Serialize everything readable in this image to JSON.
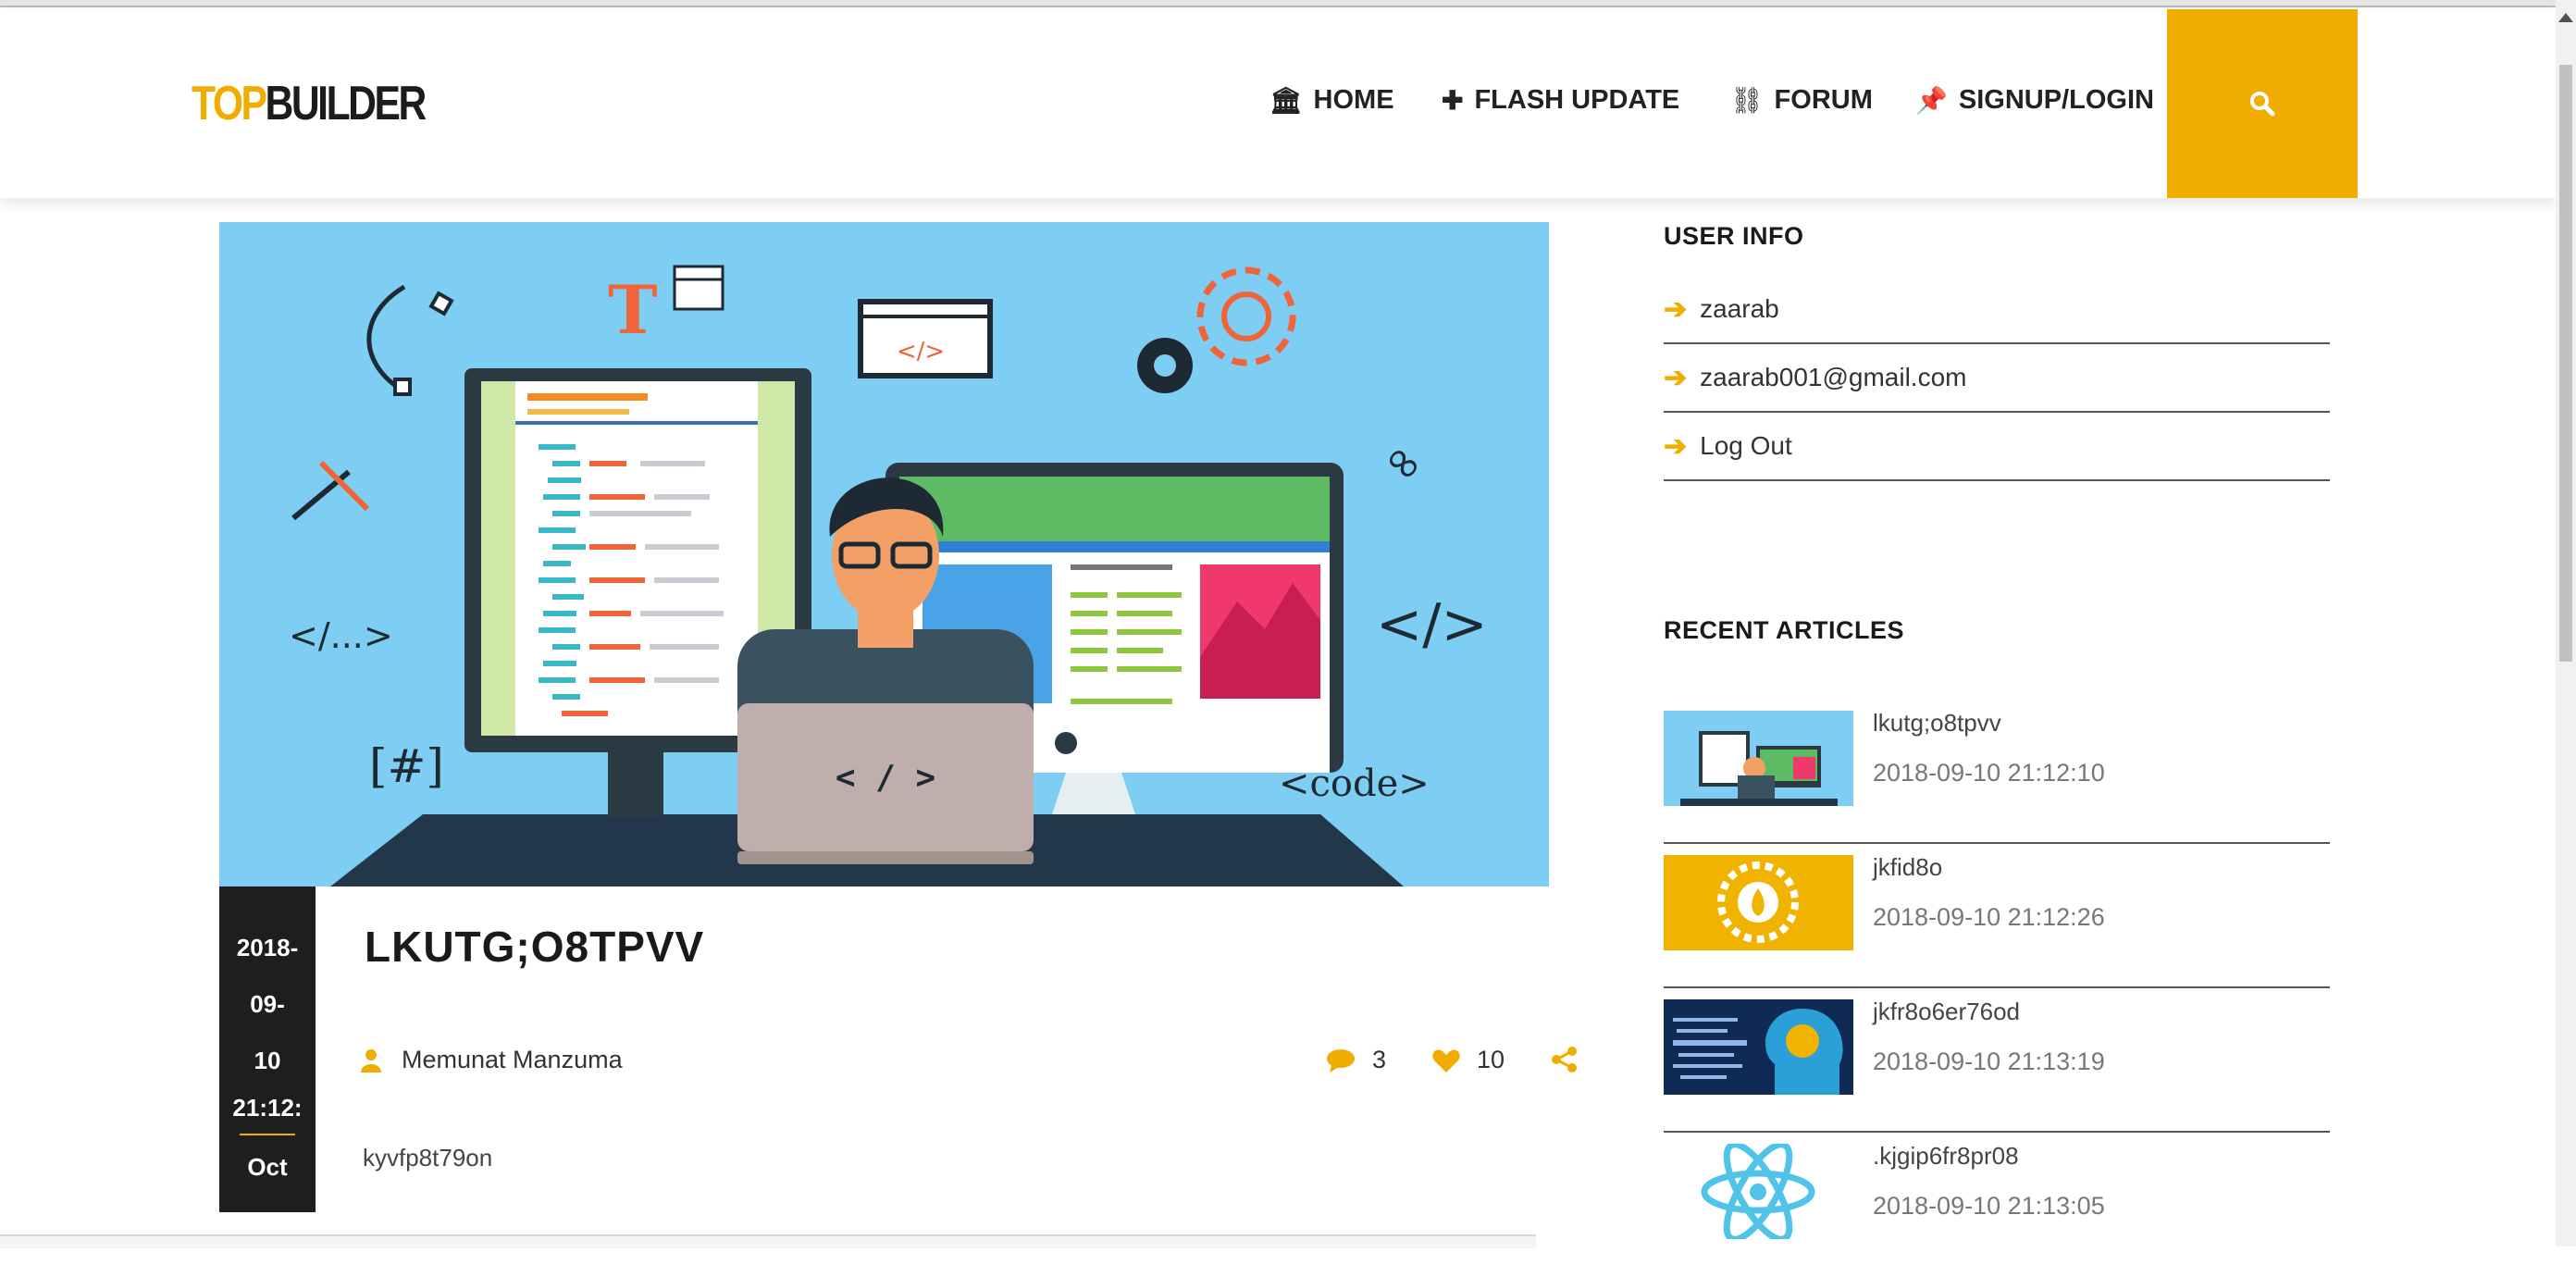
{
  "brand": {
    "logo_a": "TOP",
    "logo_b": "BUILDER"
  },
  "nav": {
    "items": [
      {
        "icon": "bank-icon",
        "label": "HOME"
      },
      {
        "icon": "plus-icon",
        "label": "FLASH UPDATE"
      },
      {
        "icon": "link-icon",
        "label": "FORUM"
      },
      {
        "icon": "pin-icon",
        "label": "SIGNUP/LOGIN"
      }
    ],
    "search_icon": "search-icon"
  },
  "post": {
    "date_lines": [
      "2018-",
      "09-",
      "10",
      "21:12:"
    ],
    "month": "Oct",
    "title": "LKUTG;O8TPVV",
    "author": "Memunat Manzuma",
    "comments": "3",
    "likes": "10",
    "excerpt": "kyvfp8t79on",
    "hero_text": {
      "t_letter": "T",
      "code1": "</...>",
      "code2": "</>",
      "hash": "[#]",
      "code3": "<code>",
      "laptop": "< / >",
      "window": "</>"
    }
  },
  "sidebar": {
    "user_info_title": "USER INFO",
    "user_items": [
      "zaarab",
      "zaarab001@gmail.com",
      "Log Out"
    ],
    "recent_title": "RECENT ARTICLES",
    "articles": [
      {
        "title": "lkutg;o8tpvv",
        "date": "2018-09-10 21:12:10"
      },
      {
        "title": "jkfid8o",
        "date": "2018-09-10 21:12:26"
      },
      {
        "title": "jkfr8o6er76od",
        "date": "2018-09-10 21:13:19"
      },
      {
        "title": ".kjgip6fr8pr08",
        "date": "2018-09-10 21:13:05"
      }
    ]
  },
  "colors": {
    "accent": "#f0ad00",
    "hero_bg": "#7ecdf3",
    "dark": "#1e1e1e"
  }
}
